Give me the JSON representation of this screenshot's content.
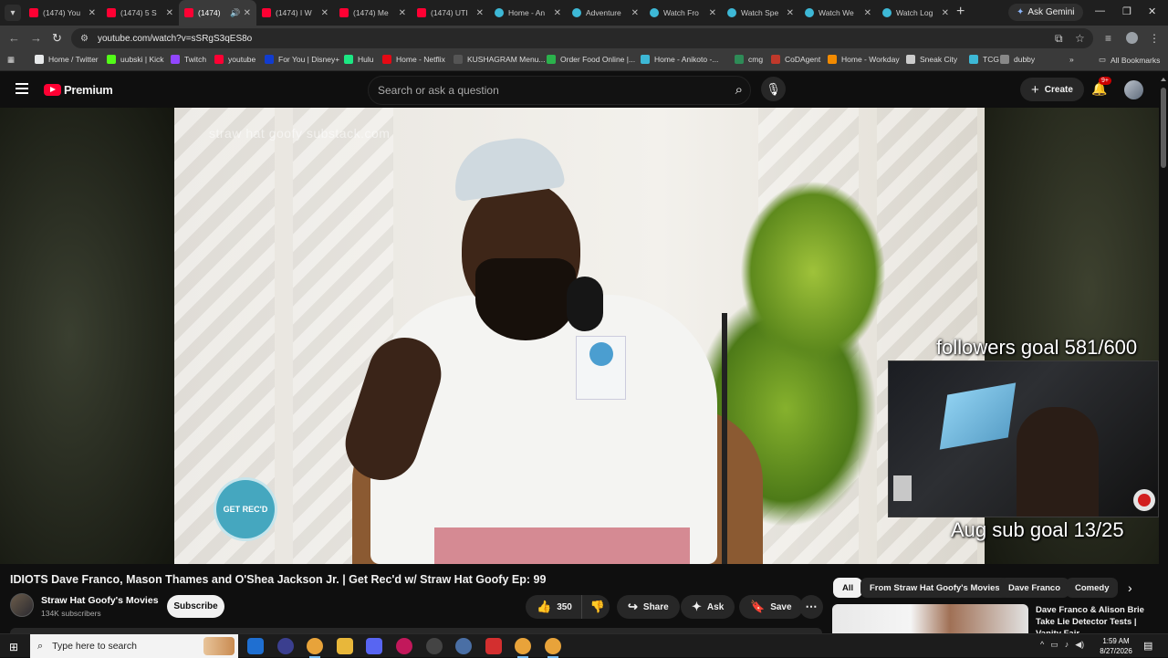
{
  "browser": {
    "tabs": [
      {
        "label": "(1474) You",
        "icon": "youtube-favicon",
        "active": false
      },
      {
        "label": "(1474) 5 S",
        "icon": "youtube-favicon",
        "active": false
      },
      {
        "label": "(1474)",
        "icon": "youtube-favicon",
        "active": true
      },
      {
        "label": "(1474) I W",
        "icon": "youtube-favicon",
        "active": false
      },
      {
        "label": "(1474) Me",
        "icon": "youtube-favicon",
        "active": false
      },
      {
        "label": "(1474) UTI",
        "icon": "youtube-favicon",
        "active": false
      },
      {
        "label": "Home - An",
        "icon": "globe-favicon",
        "active": false
      },
      {
        "label": "Adventure",
        "icon": "globe-favicon",
        "active": false
      },
      {
        "label": "Watch Fro",
        "icon": "globe-favicon",
        "active": false
      },
      {
        "label": "Watch Spe",
        "icon": "globe-favicon",
        "active": false
      },
      {
        "label": "Watch We",
        "icon": "globe-favicon",
        "active": false
      },
      {
        "label": "Watch Log",
        "icon": "globe-favicon",
        "active": false
      }
    ],
    "ask_gemini": "Ask Gemini",
    "url": "youtube.com/watch?v=sSRgS3qES8o",
    "bookmarks": [
      {
        "label": "Home / Twitter",
        "color": "#e7e9ea"
      },
      {
        "label": "uubski | Kick",
        "color": "#53fc18"
      },
      {
        "label": "Twitch",
        "color": "#9146ff"
      },
      {
        "label": "youtube",
        "color": "#ff0033"
      },
      {
        "label": "For You | Disney+",
        "color": "#113ccf"
      },
      {
        "label": "Hulu",
        "color": "#1ce783"
      },
      {
        "label": "Home - Netflix",
        "color": "#e50914"
      },
      {
        "label": "KUSHAGRAM Menu...",
        "color": "#555555"
      },
      {
        "label": "Order Food Online |...",
        "color": "#2bb24c"
      },
      {
        "label": "Home - Anikoto -...",
        "color": "#3db8d6"
      },
      {
        "label": "cmg",
        "color": "#2e8b57"
      },
      {
        "label": "CoDAgent",
        "color": "#c0392b"
      },
      {
        "label": "Home - Workday",
        "color": "#f38b00"
      },
      {
        "label": "Sneak City",
        "color": "#cccccc"
      },
      {
        "label": "TCG",
        "color": "#3db8d6"
      },
      {
        "label": "dubby",
        "color": "#888888"
      }
    ],
    "all_bookmarks": "All Bookmarks"
  },
  "youtube": {
    "brand": "Premium",
    "search_placeholder": "Search or ask a question",
    "create_label": "Create",
    "notification_badge": "9+",
    "video": {
      "watermark": "straw hat goofy substack.com",
      "logo_text": "GET REC'D",
      "overlay_followers": "followers goal 581/600",
      "overlay_subgoal": "Aug sub goal 13/25"
    },
    "title": "IDIOTS Dave Franco, Mason Thames and O'Shea Jackson Jr. | Get Rec'd w/ Straw Hat Goofy Ep: 99",
    "channel_name": "Straw Hat Goofy's Movies",
    "subscribers": "134K subscribers",
    "subscribe_label": "Subscribe",
    "likes": "350",
    "share_label": "Share",
    "ask_label": "Ask",
    "save_label": "Save",
    "chips": [
      "All",
      "From Straw Hat Goofy's Movies",
      "Dave Franco",
      "Comedy"
    ],
    "recommendation_title": "Dave Franco & Alison Brie Take Lie Detector Tests | Vanity Fair"
  },
  "taskbar": {
    "search_placeholder": "Type here to search",
    "time": "1:59 AM",
    "date": "8/27/2026"
  }
}
